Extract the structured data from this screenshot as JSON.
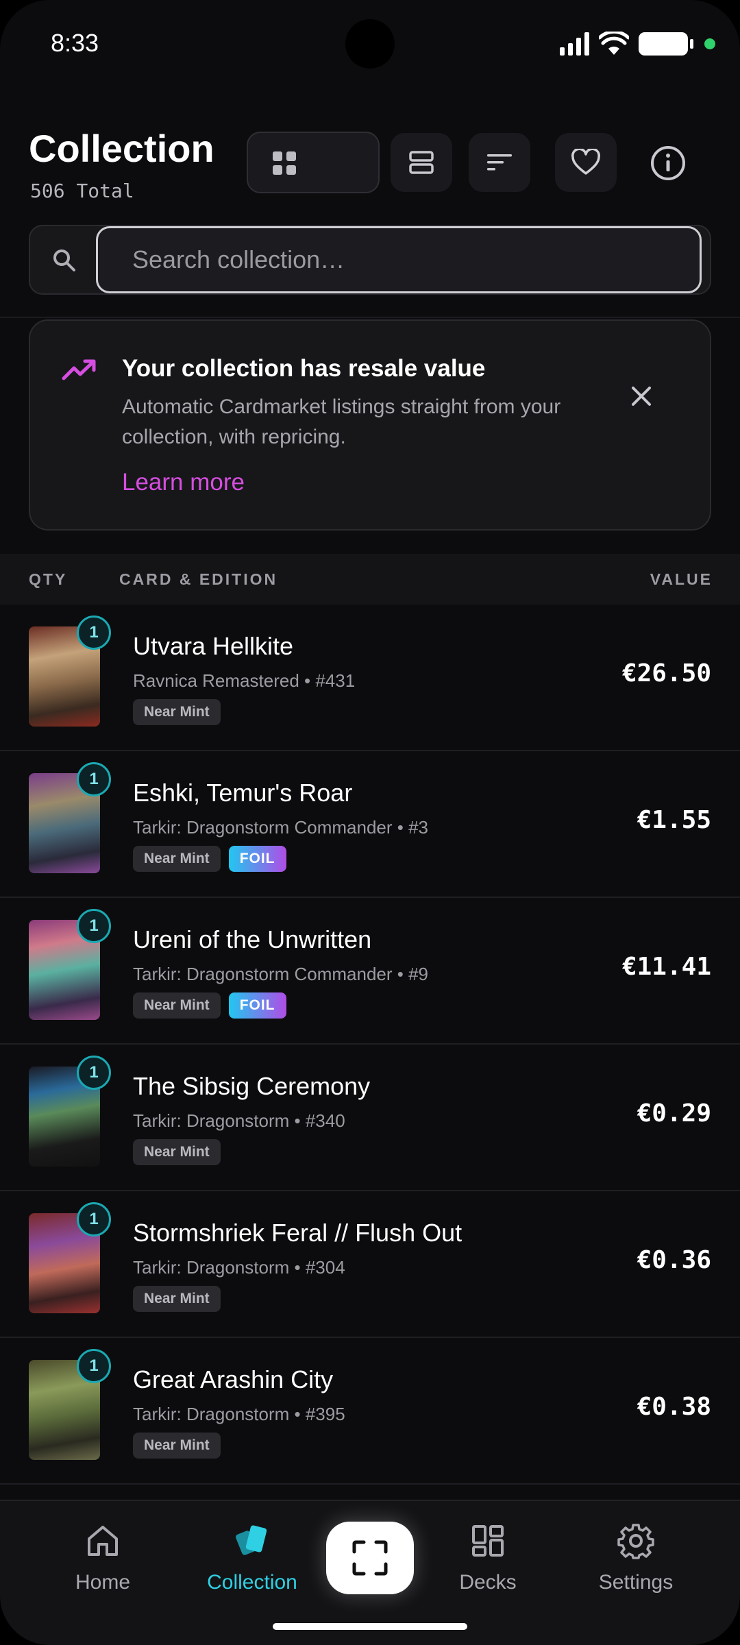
{
  "status": {
    "time": "8:33"
  },
  "header": {
    "title": "Collection",
    "total": "506 Total"
  },
  "search": {
    "placeholder": "Search collection…"
  },
  "banner": {
    "title": "Your collection has resale value",
    "text": "Automatic Cardmarket listings straight from your collection, with repricing.",
    "link": "Learn more"
  },
  "table": {
    "col_qty": "QTY",
    "col_card": "CARD & EDITION",
    "col_value": "VALUE"
  },
  "cards": [
    {
      "qty": "1",
      "name": "Utvara Hellkite",
      "edition": "Ravnica Remastered • #431",
      "condition": "Near Mint",
      "foil": "",
      "price": "€26.50"
    },
    {
      "qty": "1",
      "name": "Eshki, Temur's Roar",
      "edition": "Tarkir: Dragonstorm Commander • #3",
      "condition": "Near Mint",
      "foil": "FOIL",
      "price": "€1.55"
    },
    {
      "qty": "1",
      "name": "Ureni of the Unwritten",
      "edition": "Tarkir: Dragonstorm Commander • #9",
      "condition": "Near Mint",
      "foil": "FOIL",
      "price": "€11.41"
    },
    {
      "qty": "1",
      "name": "The Sibsig Ceremony",
      "edition": "Tarkir: Dragonstorm • #340",
      "condition": "Near Mint",
      "foil": "",
      "price": "€0.29"
    },
    {
      "qty": "1",
      "name": "Stormshriek Feral // Flush Out",
      "edition": "Tarkir: Dragonstorm • #304",
      "condition": "Near Mint",
      "foil": "",
      "price": "€0.36"
    },
    {
      "qty": "1",
      "name": "Great Arashin City",
      "edition": "Tarkir: Dragonstorm • #395",
      "condition": "Near Mint",
      "foil": "",
      "price": "€0.38"
    }
  ],
  "nav": {
    "home": "Home",
    "collection": "Collection",
    "decks": "Decks",
    "settings": "Settings"
  },
  "colors": {
    "accent": "#2fd0e3",
    "link": "#d64ee0",
    "background": "#0c0c0e"
  }
}
